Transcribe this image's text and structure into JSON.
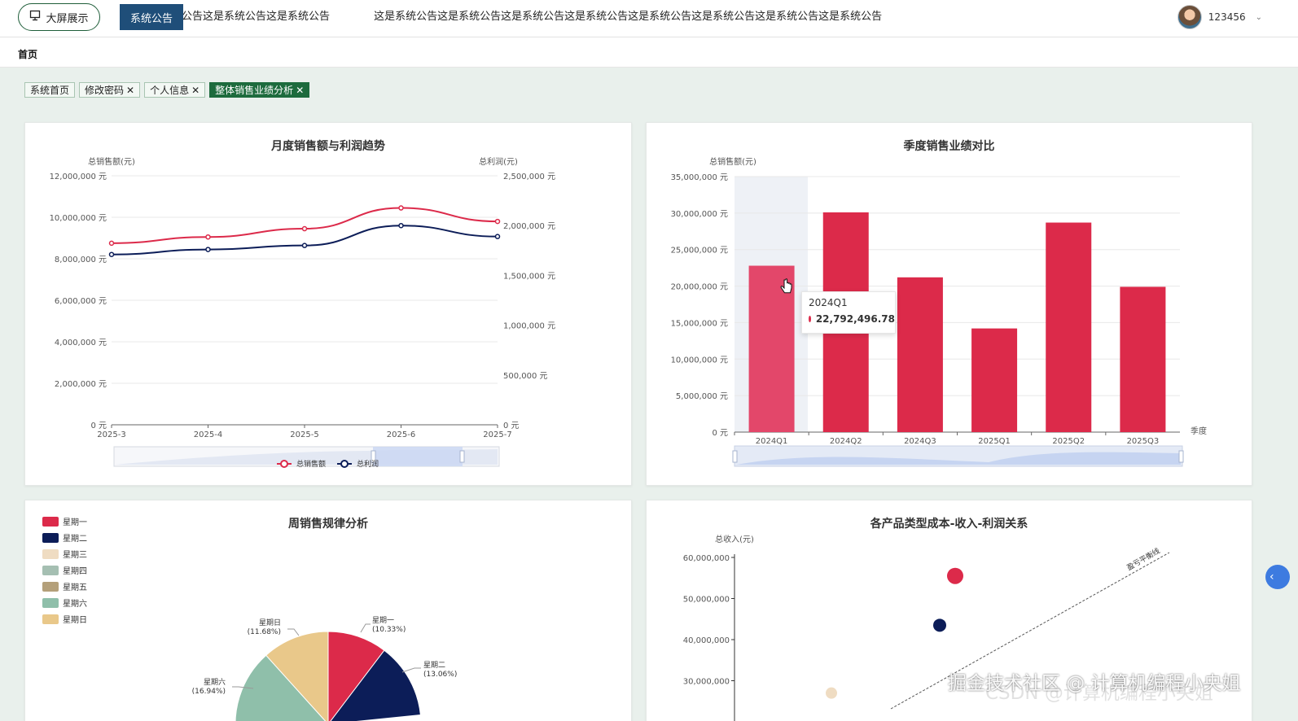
{
  "header": {
    "screen_button_label": "大屏展示",
    "notice_label": "系统公告",
    "notice_text": "这是系统公告这是系统公告这是系统公告这是系统公告这是系统公告这是系统公告这是系统公告这是系统公告",
    "notice_text_partial": "公告这是系统公告这是系统公告",
    "username": "123456"
  },
  "breadcrumb": "首页",
  "tabs": [
    {
      "label": "系统首页",
      "closable": false,
      "active": false
    },
    {
      "label": "修改密码",
      "closable": true,
      "active": false
    },
    {
      "label": "个人信息",
      "closable": true,
      "active": false
    },
    {
      "label": "整体销售业绩分析",
      "closable": true,
      "active": true
    }
  ],
  "close_glyph": "✕",
  "colors": {
    "red": "#dc2a4a",
    "navy": "#0c1d58",
    "primary": "#1d6b3d"
  },
  "charts": {
    "monthly": {
      "title": "月度销售额与利润趋势",
      "ylabel_left": "总销售额(元)",
      "ylabel_right": "总利润(元)",
      "left_ticks": [
        "0 元",
        "2,000,000 元",
        "4,000,000 元",
        "6,000,000 元",
        "8,000,000 元",
        "10,000,000 元",
        "12,000,000 元"
      ],
      "right_ticks": [
        "0 元",
        "500,000 元",
        "1,000,000 元",
        "1,500,000 元",
        "2,000,000 元",
        "2,500,000 元"
      ],
      "legend": [
        "总销售额",
        "总利润"
      ]
    },
    "quarterly": {
      "title": "季度销售业绩对比",
      "ylabel": "总销售额(元)",
      "xlabel": "季度",
      "y_ticks": [
        "0 元",
        "5,000,000 元",
        "10,000,000 元",
        "15,000,000 元",
        "20,000,000 元",
        "25,000,000 元",
        "30,000,000 元",
        "35,000,000 元"
      ],
      "tooltip": {
        "category": "2024Q1",
        "value": "22,792,496.78"
      }
    },
    "weekly": {
      "title": "周销售规律分析",
      "legend": [
        "星期一",
        "星期二",
        "星期三",
        "星期四",
        "星期五",
        "星期六",
        "星期日"
      ],
      "legend_colors": [
        "#dc2a4a",
        "#0c1d58",
        "#efdcc2",
        "#a5bfb2",
        "#b4a07a",
        "#8fbfaa",
        "#e9c88a"
      ],
      "labels": [
        {
          "name": "星期一",
          "pct": "(10.33%)"
        },
        {
          "name": "星期二",
          "pct": "(13.06%)"
        },
        {
          "name": "星期六",
          "pct": "(16.94%)"
        },
        {
          "name": "星期日",
          "pct": "(11.68%)"
        }
      ]
    },
    "cost_scatter": {
      "title": "各产品类型成本-收入-利润关系",
      "ylabel": "总收入(元)",
      "y_ticks": [
        "30,000,000",
        "40,000,000",
        "50,000,000",
        "60,000,000"
      ],
      "breakeven_label": "盈亏平衡线"
    }
  },
  "chart_data": [
    {
      "type": "line",
      "title": "月度销售额与利润趋势",
      "x": [
        "2025-3",
        "2025-4",
        "2025-5",
        "2025-6",
        "2025-7"
      ],
      "ylabel": "总销售额(元)",
      "y2label": "总利润(元)",
      "ylim": [
        0,
        12000000
      ],
      "y2lim": [
        0,
        2500000
      ],
      "series": [
        {
          "name": "总销售额",
          "axis": "left",
          "color": "#dc2a4a",
          "values": [
            8750000,
            9050000,
            9450000,
            10450000,
            9800000
          ]
        },
        {
          "name": "总利润",
          "axis": "right",
          "color": "#0c1d58",
          "values": [
            1710000,
            1760000,
            1800000,
            2000000,
            1890000
          ]
        }
      ],
      "legend": "bottom-center",
      "grid": true
    },
    {
      "type": "bar",
      "title": "季度销售业绩对比",
      "categories": [
        "2024Q1",
        "2024Q2",
        "2024Q3",
        "2025Q1",
        "2025Q2",
        "2025Q3"
      ],
      "values": [
        22792496.78,
        30100000,
        21200000,
        14200000,
        28700000,
        19900000
      ],
      "ylabel": "总销售额(元)",
      "xlabel": "季度",
      "ylim": [
        0,
        35000000
      ],
      "highlight_index": 0,
      "grid": true
    },
    {
      "type": "pie",
      "title": "周销售规律分析",
      "slices": [
        {
          "name": "星期一",
          "value": 10.33,
          "color": "#dc2a4a"
        },
        {
          "name": "星期二",
          "value": 13.06,
          "color": "#0c1d58"
        },
        {
          "name": "星期六",
          "value": 16.94,
          "color": "#8fbfaa"
        },
        {
          "name": "星期日",
          "value": 11.68,
          "color": "#e9c88a"
        }
      ],
      "legend": "top-left"
    },
    {
      "type": "scatter",
      "title": "各产品类型成本-收入-利润关系",
      "ylabel": "总收入(元)",
      "ylim": [
        25000000,
        62000000
      ],
      "points": [
        {
          "y": 55500000,
          "color": "#dc2a4a"
        },
        {
          "y": 43500000,
          "color": "#0c1d58"
        },
        {
          "y": 27000000,
          "color": "#efdcc2"
        }
      ],
      "annotation": "盈亏平衡线"
    }
  ]
}
